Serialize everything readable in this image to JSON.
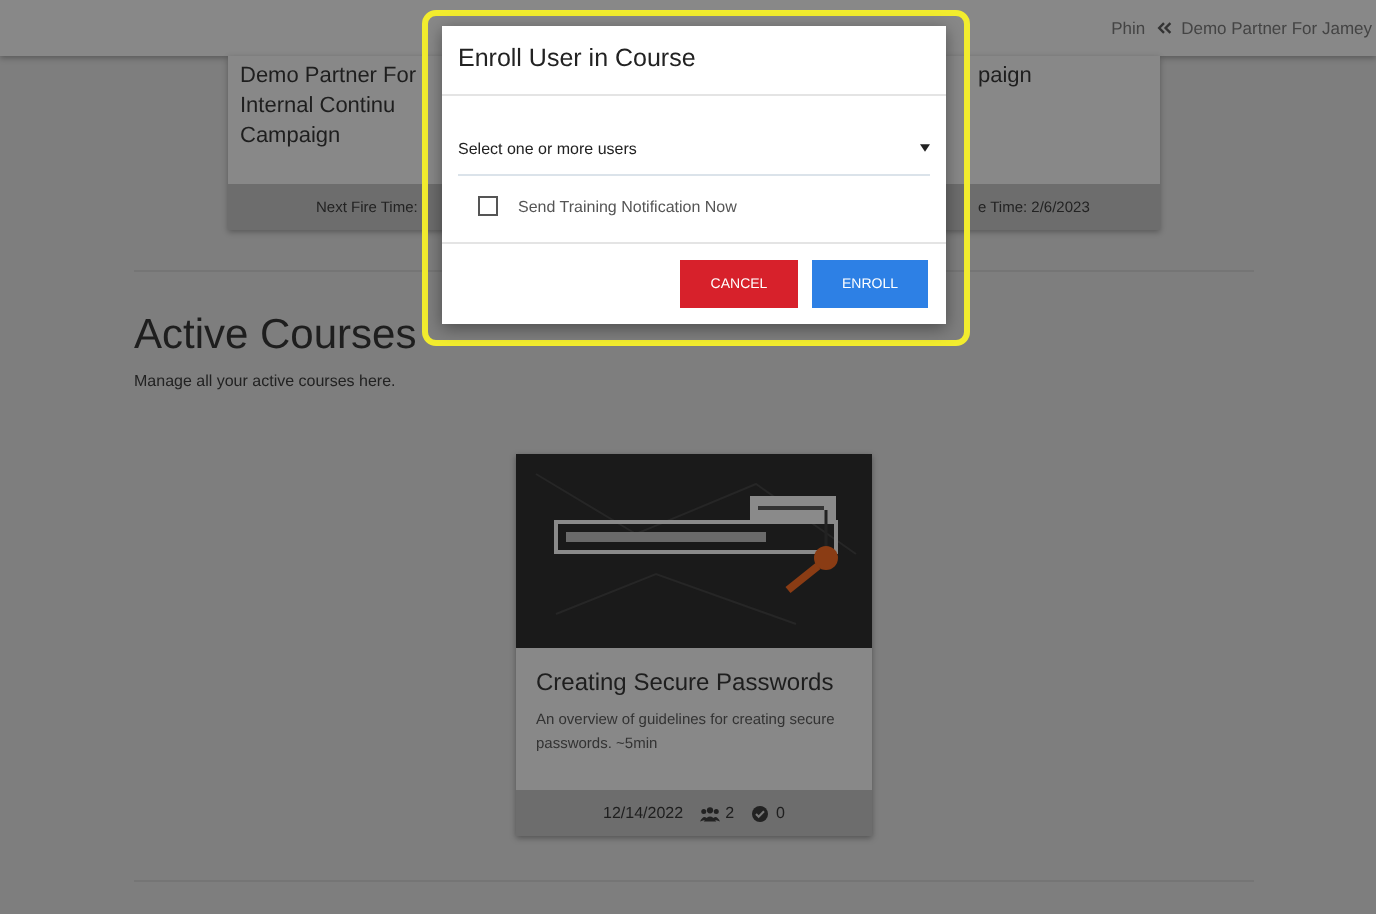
{
  "header": {
    "user": "Phin",
    "account": "Demo Partner For Jamey"
  },
  "campaigns": [
    {
      "title_lines": [
        "Demo Partner For",
        "Internal Continu",
        "Campaign"
      ],
      "footer": "Next Fire Time:"
    },
    {
      "title_lines": [
        "paign"
      ],
      "footer": "e Time: 2/6/2023"
    }
  ],
  "section": {
    "title": "Active Courses",
    "subtitle": "Manage all your active courses here."
  },
  "courses": [
    {
      "title": "Creating Secure Passwords",
      "description": "An overview of guidelines for creating secure passwords. ~5min",
      "date": "12/14/2022",
      "enrolled": "2",
      "completed": "0"
    }
  ],
  "dialog": {
    "title": "Enroll User in Course",
    "highlighted": true,
    "select": {
      "placeholder": "Select one or more users"
    },
    "notify": {
      "label": "Send Training Notification Now",
      "checked": false
    },
    "buttons": [
      {
        "kind": "cancel",
        "label": "CANCEL"
      },
      {
        "kind": "primary",
        "label": "ENROLL"
      }
    ]
  }
}
